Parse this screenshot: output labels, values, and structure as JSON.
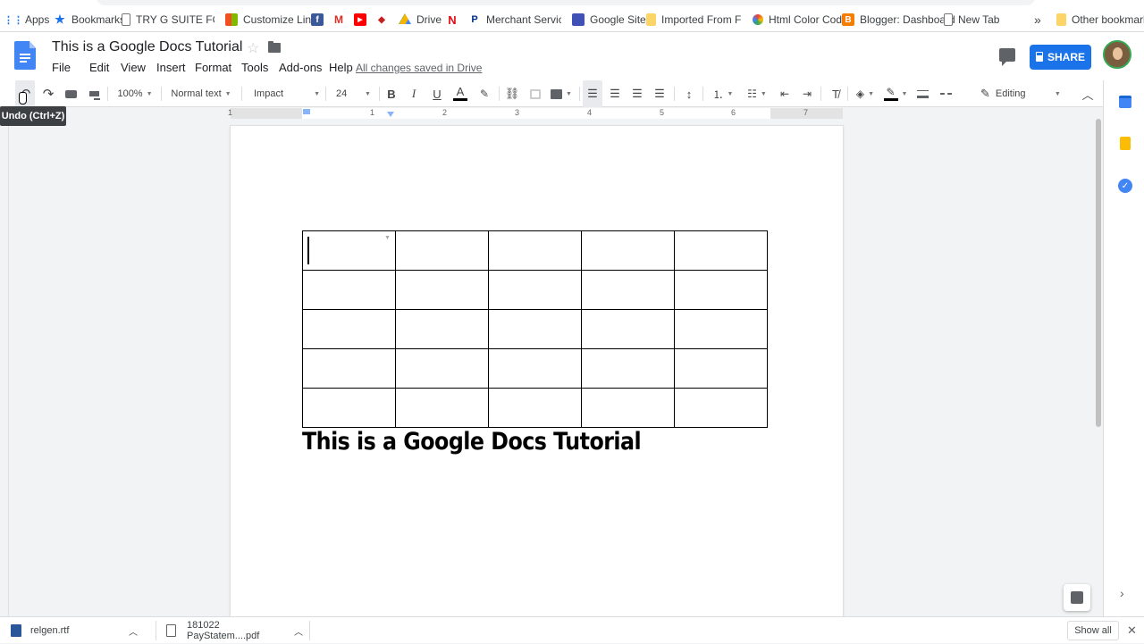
{
  "bookmarks": [
    {
      "label": "Apps",
      "icon": "apps-grid-icon"
    },
    {
      "label": "Bookmarks",
      "icon": "star-icon"
    },
    {
      "label": "TRY G SUITE FOR FR",
      "icon": "page-icon"
    },
    {
      "label": "Customize Links",
      "icon": "windows-icon"
    },
    {
      "label": "",
      "icon": "facebook-icon"
    },
    {
      "label": "",
      "icon": "gmail-icon"
    },
    {
      "label": "",
      "icon": "youtube-icon"
    },
    {
      "label": "",
      "icon": "wing-icon"
    },
    {
      "label": "Drive",
      "icon": "drive-icon"
    },
    {
      "label": "",
      "icon": "netflix-icon"
    },
    {
      "label": "Merchant Services fr",
      "icon": "paypal-icon"
    },
    {
      "label": "Google Sites",
      "icon": "sites-icon"
    },
    {
      "label": "Imported From Firefo",
      "icon": "folder-icon"
    },
    {
      "label": "Html Color Codes",
      "icon": "color-wheel-icon"
    },
    {
      "label": "Blogger: Dashboard",
      "icon": "blogger-icon"
    },
    {
      "label": "New Tab",
      "icon": "page-icon"
    }
  ],
  "bookmarks_overflow": "»",
  "other_bookmarks": "Other bookmarks",
  "doc": {
    "title": "This is a Google Docs Tutorial",
    "star": "☆",
    "saved_status": "All changes saved in Drive",
    "menu": [
      "File",
      "Edit",
      "View",
      "Insert",
      "Format",
      "Tools",
      "Add-ons",
      "Help"
    ],
    "share_label": "SHARE"
  },
  "toolbar": {
    "zoom": "100%",
    "style": "Normal text",
    "font": "Impact",
    "font_size": "24",
    "mode": "Editing",
    "tooltip": "Undo (Ctrl+Z)"
  },
  "ruler": {
    "numbers": [
      "1",
      "1",
      "2",
      "3",
      "4",
      "5",
      "6",
      "7"
    ]
  },
  "table": {
    "rows": 5,
    "cols": 5
  },
  "heading": "This is a Google Docs Tutorial",
  "downloads": [
    {
      "name": "relgen.rtf",
      "icon": "word-doc-icon"
    },
    {
      "name": "181022 PayStatem....pdf",
      "icon": "pdf-icon"
    }
  ],
  "show_all": "Show all",
  "colors": {
    "accent": "#1a73e8",
    "docs_blue": "#4285f4"
  }
}
